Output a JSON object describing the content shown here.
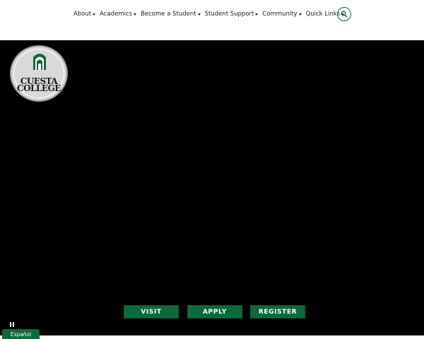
{
  "nav": {
    "items": [
      {
        "label": "About"
      },
      {
        "label": "Academics"
      },
      {
        "label": "Become a Student"
      },
      {
        "label": "Student Support"
      },
      {
        "label": "Community"
      },
      {
        "label": "Quick Links"
      }
    ],
    "search_icon": "search-icon"
  },
  "logo": {
    "line1": "CUESTA",
    "line2": "COLLEGE"
  },
  "cta": {
    "visit": "VISIT",
    "apply": "APPLY",
    "register": "REGISTER"
  },
  "language_button": "Español",
  "colors": {
    "brand_green": "#0b6b3a",
    "hero_background": "#000000",
    "header_background": "#ffffff"
  }
}
